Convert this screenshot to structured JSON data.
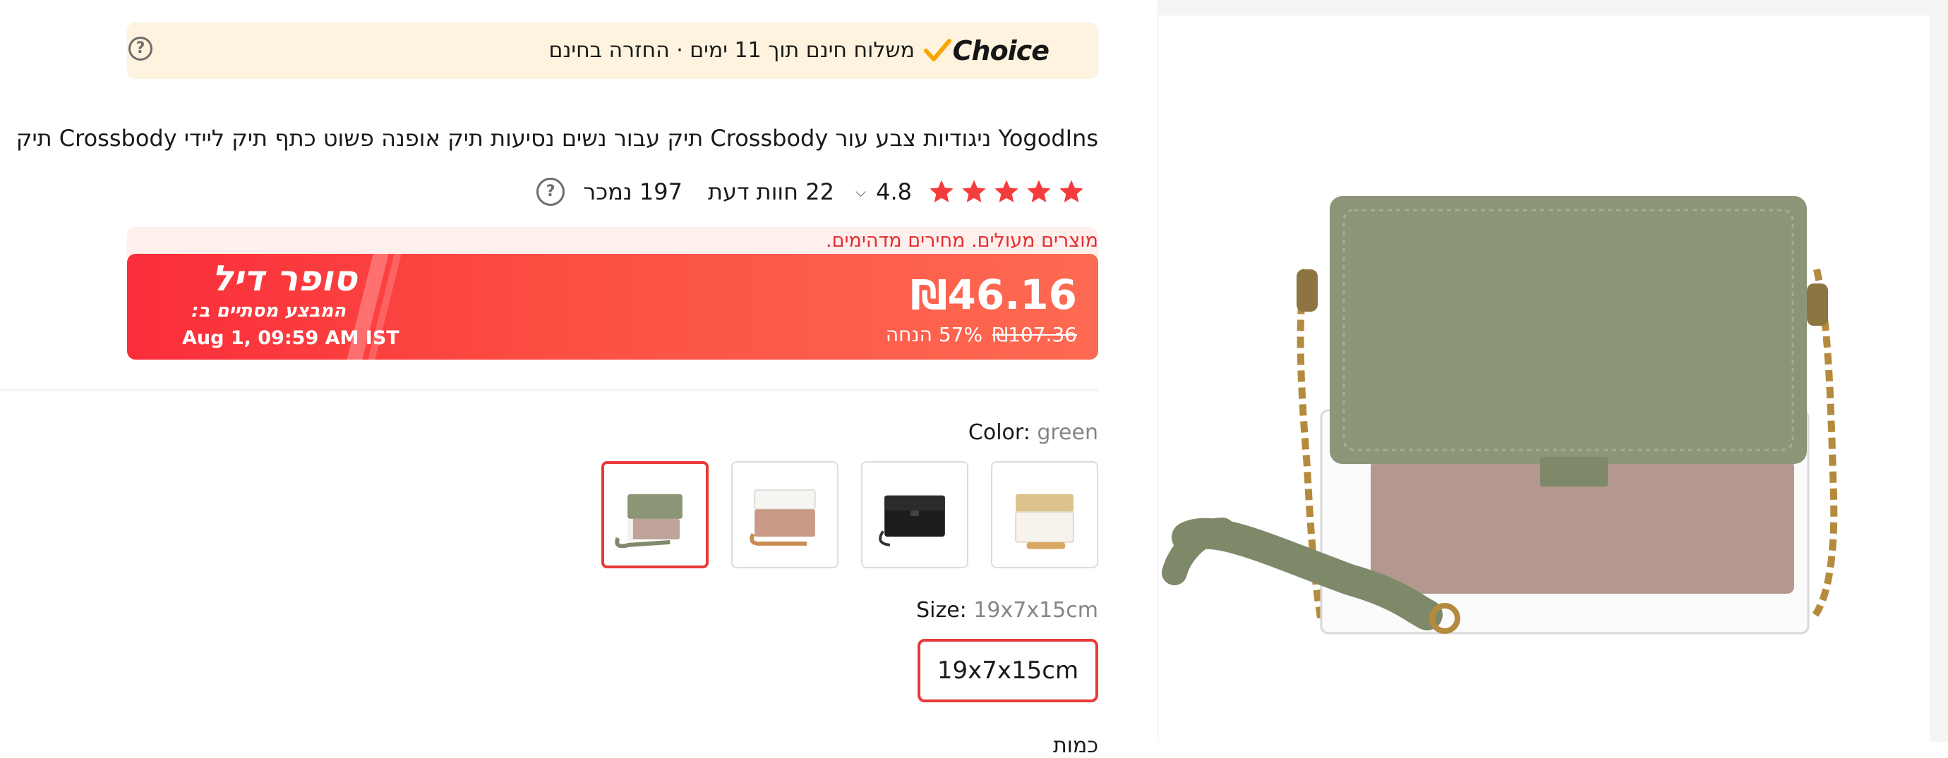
{
  "banner": {
    "logo_text": "Choice",
    "text": "משלוח חינם תוך 11 ימים · החזרה בחינם",
    "help_icon": "question-circle-icon"
  },
  "product": {
    "title": "YogodIns ניגודיות צבע עור Crossbody תיק עבור נשים נסיעות תיק אופנה פשוט כתף תיק ליידי Crossbody תיק"
  },
  "rating": {
    "value": "4.8",
    "stars": 5,
    "reviews": "22 חוות דעת",
    "sold": "197 נמכר",
    "star_color": "#f43c3c"
  },
  "deal": {
    "tagline": "מוצרים מעולים. מחירים מדהימים.",
    "badge_title": "סופר דיל",
    "badge_subtitle": "המבצע מסתיים ב:",
    "end_time": "Aug 1, 09:59 AM IST",
    "price_current": "₪46.16",
    "price_original": "₪107.36",
    "discount": "57% הנחה"
  },
  "color": {
    "label": "Color:",
    "selected": "green",
    "options": [
      "green",
      "white",
      "black",
      "beige"
    ]
  },
  "size": {
    "label": "Size:",
    "selected": "19x7x15cm",
    "option": "19x7x15cm"
  },
  "next_section_label": "כמות",
  "colors": {
    "accent_red": "#e83a3a",
    "banner_bg": "#fdf3de",
    "deal_gradient_start": "#fa2d3a",
    "deal_gradient_end": "#fd6a52"
  }
}
